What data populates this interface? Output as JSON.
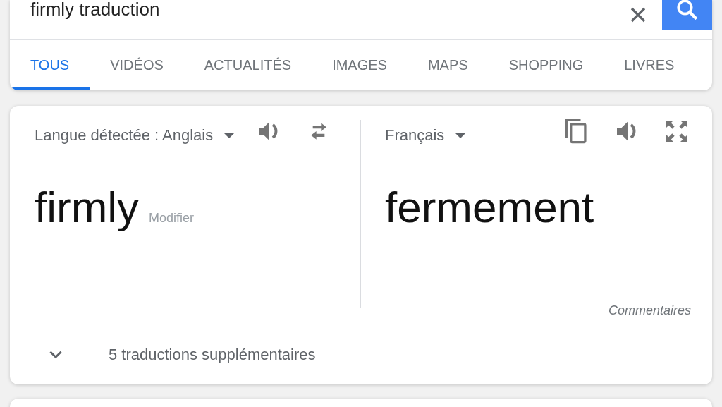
{
  "search": {
    "value": "firmly traduction"
  },
  "tabs": [
    {
      "label": "TOUS",
      "selected": true
    },
    {
      "label": "VIDÉOS",
      "selected": false
    },
    {
      "label": "ACTUALITÉS",
      "selected": false
    },
    {
      "label": "IMAGES",
      "selected": false
    },
    {
      "label": "MAPS",
      "selected": false
    },
    {
      "label": "SHOPPING",
      "selected": false
    },
    {
      "label": "LIVRES",
      "selected": false
    }
  ],
  "translator": {
    "source_language": "Langue détectée : Anglais",
    "target_language": "Français",
    "source_text": "firmly",
    "edit_link": "Modifier",
    "translation": "fermement",
    "feedback_link": "Commentaires"
  },
  "more": {
    "label": "5 traductions supplémentaires"
  }
}
